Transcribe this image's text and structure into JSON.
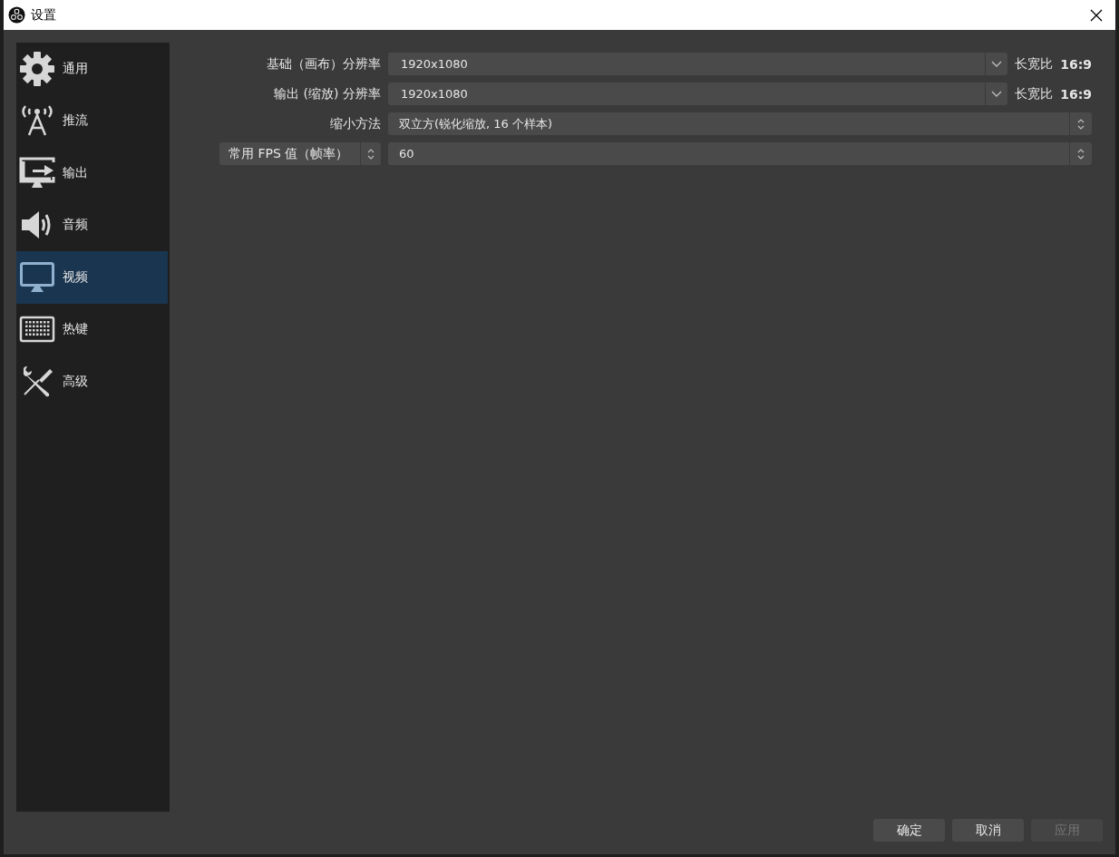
{
  "window": {
    "title": "设置"
  },
  "sidebar": {
    "items": [
      {
        "label": "通用",
        "selected": false
      },
      {
        "label": "推流",
        "selected": false
      },
      {
        "label": "输出",
        "selected": false
      },
      {
        "label": "音频",
        "selected": false
      },
      {
        "label": "视频",
        "selected": true
      },
      {
        "label": "热键",
        "selected": false
      },
      {
        "label": "高级",
        "selected": false
      }
    ]
  },
  "form": {
    "rows": [
      {
        "kind": "combo",
        "label": "基础（画布）分辨率",
        "value": "1920x1080",
        "aspect_label": "长宽比",
        "aspect_value": "16:9"
      },
      {
        "kind": "combo",
        "label": "输出 (缩放) 分辨率",
        "value": "1920x1080",
        "aspect_label": "长宽比",
        "aspect_value": "16:9"
      },
      {
        "kind": "select",
        "label": "缩小方法",
        "value": "双立方(锐化缩放, 16 个样本)"
      },
      {
        "kind": "dual-select",
        "label": "常用 FPS 值（帧率）",
        "value": "60"
      }
    ]
  },
  "buttons": [
    {
      "label": "确定",
      "disabled": false
    },
    {
      "label": "取消",
      "disabled": false
    },
    {
      "label": "应用",
      "disabled": true
    }
  ]
}
